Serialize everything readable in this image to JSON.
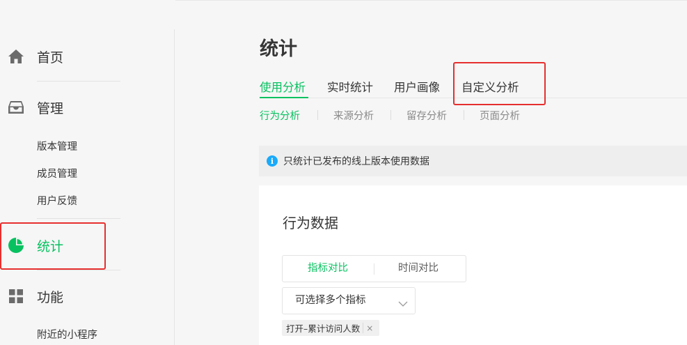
{
  "sidebar": {
    "home": {
      "label": "首页",
      "icon": "home-icon"
    },
    "manage": {
      "label": "管理",
      "icon": "inbox-icon",
      "items": [
        {
          "label": "版本管理"
        },
        {
          "label": "成员管理"
        },
        {
          "label": "用户反馈"
        }
      ]
    },
    "stats": {
      "label": "统计",
      "icon": "pie-chart-icon",
      "active": true
    },
    "features": {
      "label": "功能",
      "icon": "grid-icon",
      "items": [
        {
          "label": "附近的小程序"
        }
      ]
    }
  },
  "main": {
    "title": "统计",
    "tabs": [
      {
        "label": "使用分析",
        "active": true
      },
      {
        "label": "实时统计"
      },
      {
        "label": "用户画像"
      },
      {
        "label": "自定义分析"
      }
    ],
    "subtabs": [
      {
        "label": "行为分析",
        "active": true
      },
      {
        "label": "来源分析"
      },
      {
        "label": "留存分析"
      },
      {
        "label": "页面分析"
      }
    ],
    "notice": {
      "icon": "info-icon",
      "glyph": "i",
      "text": "只统计已发布的线上版本使用数据"
    },
    "card": {
      "title": "行为数据",
      "segments": [
        {
          "label": "指标对比",
          "active": true
        },
        {
          "label": "时间对比"
        }
      ],
      "select": {
        "value": "可选择多个指标"
      },
      "tags": [
        {
          "label": "打开–累计访问人数",
          "remove": "×"
        }
      ]
    }
  },
  "colors": {
    "accent": "#07c160",
    "highlight": "#e62e2e",
    "info": "#1aaafa"
  }
}
